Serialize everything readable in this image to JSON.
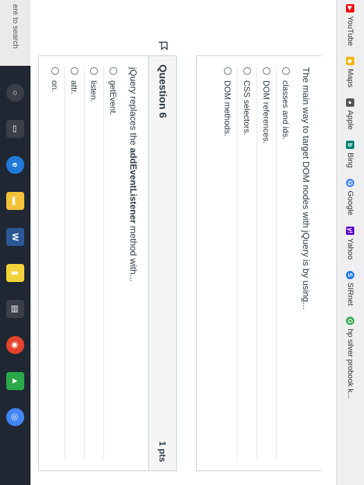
{
  "bookmarks": [
    {
      "label": "YouTube",
      "icon": "youtube-icon",
      "color": "#ff0000"
    },
    {
      "label": "Maps",
      "icon": "maps-icon",
      "color": "#f4b400"
    },
    {
      "label": "Apple",
      "icon": "apple-icon",
      "color": "#555555"
    },
    {
      "label": "Bing",
      "icon": "bing-icon",
      "color": "#008373"
    },
    {
      "label": "Google",
      "icon": "google-icon",
      "color": "#4285f4"
    },
    {
      "label": "Yahoo",
      "icon": "yahoo-icon",
      "color": "#5f01d1"
    },
    {
      "label": "SIRnet",
      "icon": "sirnet-icon",
      "color": "#1a73e8"
    },
    {
      "label": "hp silver probook k...",
      "icon": "google-search-icon",
      "color": "#34a853"
    }
  ],
  "questions": [
    {
      "text": "The main way to target DOM nodes with jQuery is by using...",
      "answers": [
        "classes and ids.",
        "DOM references.",
        "CSS selectors.",
        "DOM methods."
      ]
    },
    {
      "title": "Question 6",
      "points": "1 pts",
      "text_before": "jQuery replaces the ",
      "text_bold": "addEventListener",
      "text_after": " method with...",
      "answers": [
        "getEvent.",
        "listen.",
        "attr.",
        "on."
      ]
    }
  ],
  "taskbar": {
    "search_placeholder": "ere to search",
    "icons": [
      {
        "name": "cortana-icon",
        "color": "#3a3f48"
      },
      {
        "name": "task-view-icon",
        "color": "#3a3f48"
      },
      {
        "name": "edge-icon",
        "color": "#1e7ad6"
      },
      {
        "name": "file-explorer-icon",
        "color": "#f3c13a"
      },
      {
        "name": "word-icon",
        "color": "#2b5797"
      },
      {
        "name": "sticky-notes-icon",
        "color": "#f3d33a"
      },
      {
        "name": "store-icon",
        "color": "#3a3f48"
      },
      {
        "name": "media-icon",
        "color": "#e5432c"
      },
      {
        "name": "photos-icon",
        "color": "#2aa84a"
      },
      {
        "name": "chrome-icon",
        "color": "#4285f4"
      }
    ]
  }
}
